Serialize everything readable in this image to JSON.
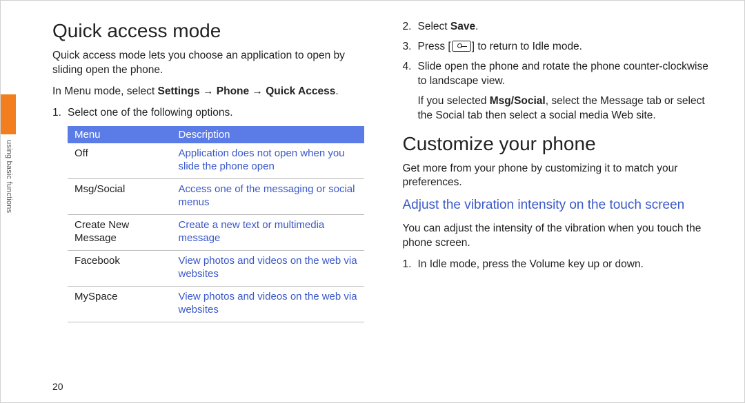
{
  "side_tab": {
    "label": "using basic functions"
  },
  "page_number": "20",
  "left": {
    "heading": "Quick access mode",
    "intro": "Quick access mode lets you choose an application to open by sliding open the phone.",
    "menu_path_pre": "In Menu mode, select ",
    "menu_path_bold": "Settings → Phone → Quick Access",
    "menu_path_post": ".",
    "step1_num": "1.",
    "step1_text": "Select one of the following options.",
    "table": {
      "head_menu": "Menu",
      "head_desc": "Description",
      "rows": [
        {
          "menu": "Off",
          "desc": "Application does not open when you slide the phone open"
        },
        {
          "menu": "Msg/Social",
          "desc": "Access one of the messaging or social menus"
        },
        {
          "menu": "Create New Message",
          "desc": "Create a new text or multimedia message"
        },
        {
          "menu": "Facebook",
          "desc": "View photos and videos on the web via websites"
        },
        {
          "menu": "MySpace",
          "desc": "View photos and videos on the web via websites"
        }
      ]
    }
  },
  "right": {
    "step2_num": "2.",
    "step2_pre": "Select ",
    "step2_bold": "Save",
    "step2_post": ".",
    "step3_num": "3.",
    "step3_pre": "Press [",
    "step3_icon": "end-call-icon",
    "step3_post": "] to return to Idle mode.",
    "step4_num": "4.",
    "step4_text": "Slide open the phone and rotate the phone counter-clockwise to landscape view.",
    "note_pre": "If you selected ",
    "note_bold": "Msg/Social",
    "note_post": ", select the Message tab or select the Social tab then select a social media Web site.",
    "heading2": "Customize your phone",
    "intro2": "Get more from your phone by customizing it to match your preferences.",
    "subhead_blue": "Adjust the vibration intensity on the touch screen",
    "sub_intro": "You can adjust the intensity of the vibration when you touch the phone screen.",
    "sub_step1_num": "1.",
    "sub_step1_text": "In Idle mode, press the Volume key up or down."
  }
}
